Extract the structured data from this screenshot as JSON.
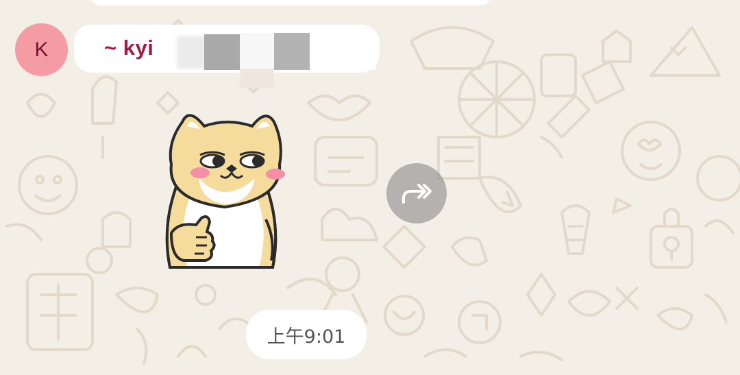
{
  "chat": {
    "previous_bubble": true,
    "message": {
      "avatar_letter": "K",
      "avatar_color": "#f49ba3",
      "sender_name": "~ kyi",
      "sender_name_color": "#a11c44",
      "name_redacted": true,
      "sticker": "shiba-inu-thumbs-up-sticker",
      "forward_icon": "forward-icon"
    },
    "timestamp": "上午9:01"
  },
  "theme": {
    "wallpaper_bg": "#f3eee6",
    "doodle_color": "#e6ddd0",
    "bubble_bg": "#ffffff"
  }
}
